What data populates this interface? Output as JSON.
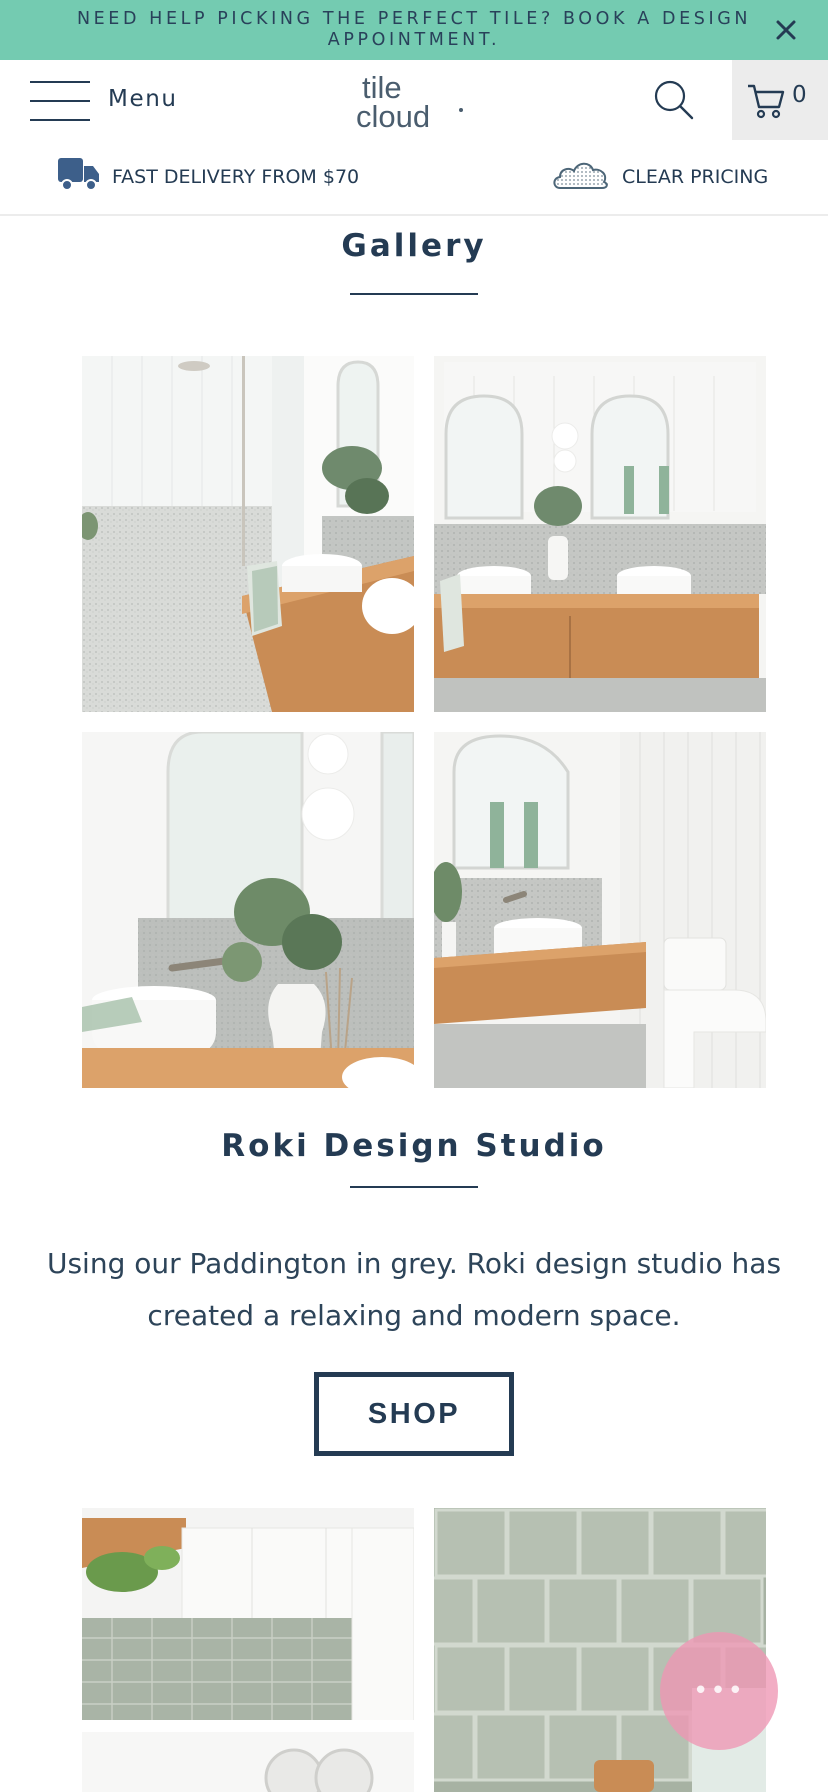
{
  "announcement": {
    "text": "NEED HELP PICKING THE PERFECT TILE? BOOK A DESIGN APPOINTMENT.",
    "close_icon": "close-icon"
  },
  "header": {
    "menu_label": "Menu",
    "logo_top": "tile",
    "logo_bottom": "cloud",
    "cart_count": "0",
    "icons": [
      "hamburger-icon",
      "search-icon",
      "cart-icon"
    ]
  },
  "value_props": [
    {
      "icon": "delivery-truck-icon",
      "text": "FAST DELIVERY FROM $70"
    },
    {
      "icon": "cloud-icon",
      "text": "CLEAR PRICING"
    }
  ],
  "gallery": {
    "title": "Gallery",
    "images": [
      "shower-vanity-photo",
      "double-vanity-photo",
      "basin-eucalyptus-photo",
      "vanity-toilet-photo"
    ]
  },
  "studio": {
    "title": "Roki Design Studio",
    "description": "Using our Paddington in grey. Roki design studio has created a relaxing and modern space.",
    "shop_label": "SHOP",
    "images": [
      "laundry-photo",
      "green-tile-photo"
    ]
  },
  "chat": {
    "icon": "chat-icon",
    "dots": "•••"
  },
  "colors": {
    "announcement_bg": "#74cbb1",
    "primary_text": "#243b53",
    "cart_bg": "#ececec",
    "chat_bubble": "#ee96b4"
  }
}
